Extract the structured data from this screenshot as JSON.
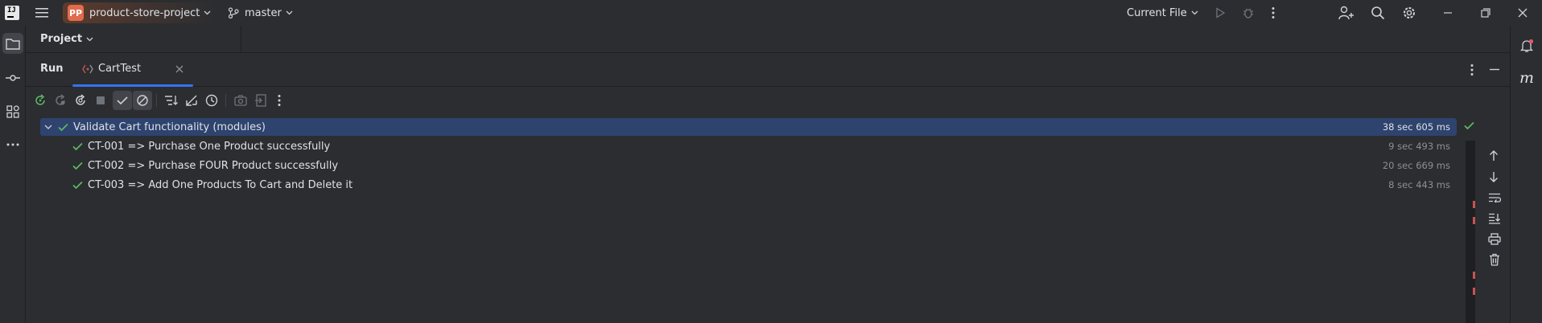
{
  "titlebar": {
    "project_badge": "PP",
    "project_name": "product-store-project",
    "branch": "master",
    "run_config": "Current File",
    "icons": [
      "app-logo",
      "main-menu-icon",
      "branch-icon",
      "run-icon",
      "debug-icon",
      "more-icon",
      "add-user-icon",
      "search-icon",
      "settings-icon",
      "minimize-icon",
      "restore-icon",
      "close-icon"
    ]
  },
  "left_strip": [
    "folder-icon",
    "commit-icon",
    "plugins-icon",
    "more-tools-icon"
  ],
  "right_strip": [
    "notifications-icon",
    "ai-assistant-icon"
  ],
  "project_bar": {
    "label": "Project"
  },
  "run_window": {
    "tab_run": "Run",
    "tab_test": "CartTest",
    "toolbar_icons": [
      "rerun-icon",
      "rerun-failed-icon",
      "toggle-auto-test-icon",
      "stop-icon",
      "show-passed-icon",
      "show-ignored-icon",
      "sort-icon",
      "collapse-icon",
      "history-icon",
      "screenshot-icon",
      "export-icon",
      "more-icon"
    ]
  },
  "tests": {
    "root": {
      "label": "Validate Cart functionality (modules)",
      "duration": "38 sec 605 ms",
      "status": "passed"
    },
    "children": [
      {
        "label": "CT-001 => Purchase One Product successfully",
        "duration": "9 sec 493 ms",
        "status": "passed"
      },
      {
        "label": "CT-002 => Purchase FOUR Product successfully",
        "duration": "20 sec 669 ms",
        "status": "passed"
      },
      {
        "label": "CT-003 => Add One Products To Cart and Delete it",
        "duration": "8 sec 443 ms",
        "status": "passed"
      }
    ]
  },
  "colors": {
    "background": "#2b2d30",
    "selection": "#2e436e",
    "accent": "#3574f0",
    "passed": "#5fb865",
    "project_badge": "#e06c4d"
  }
}
